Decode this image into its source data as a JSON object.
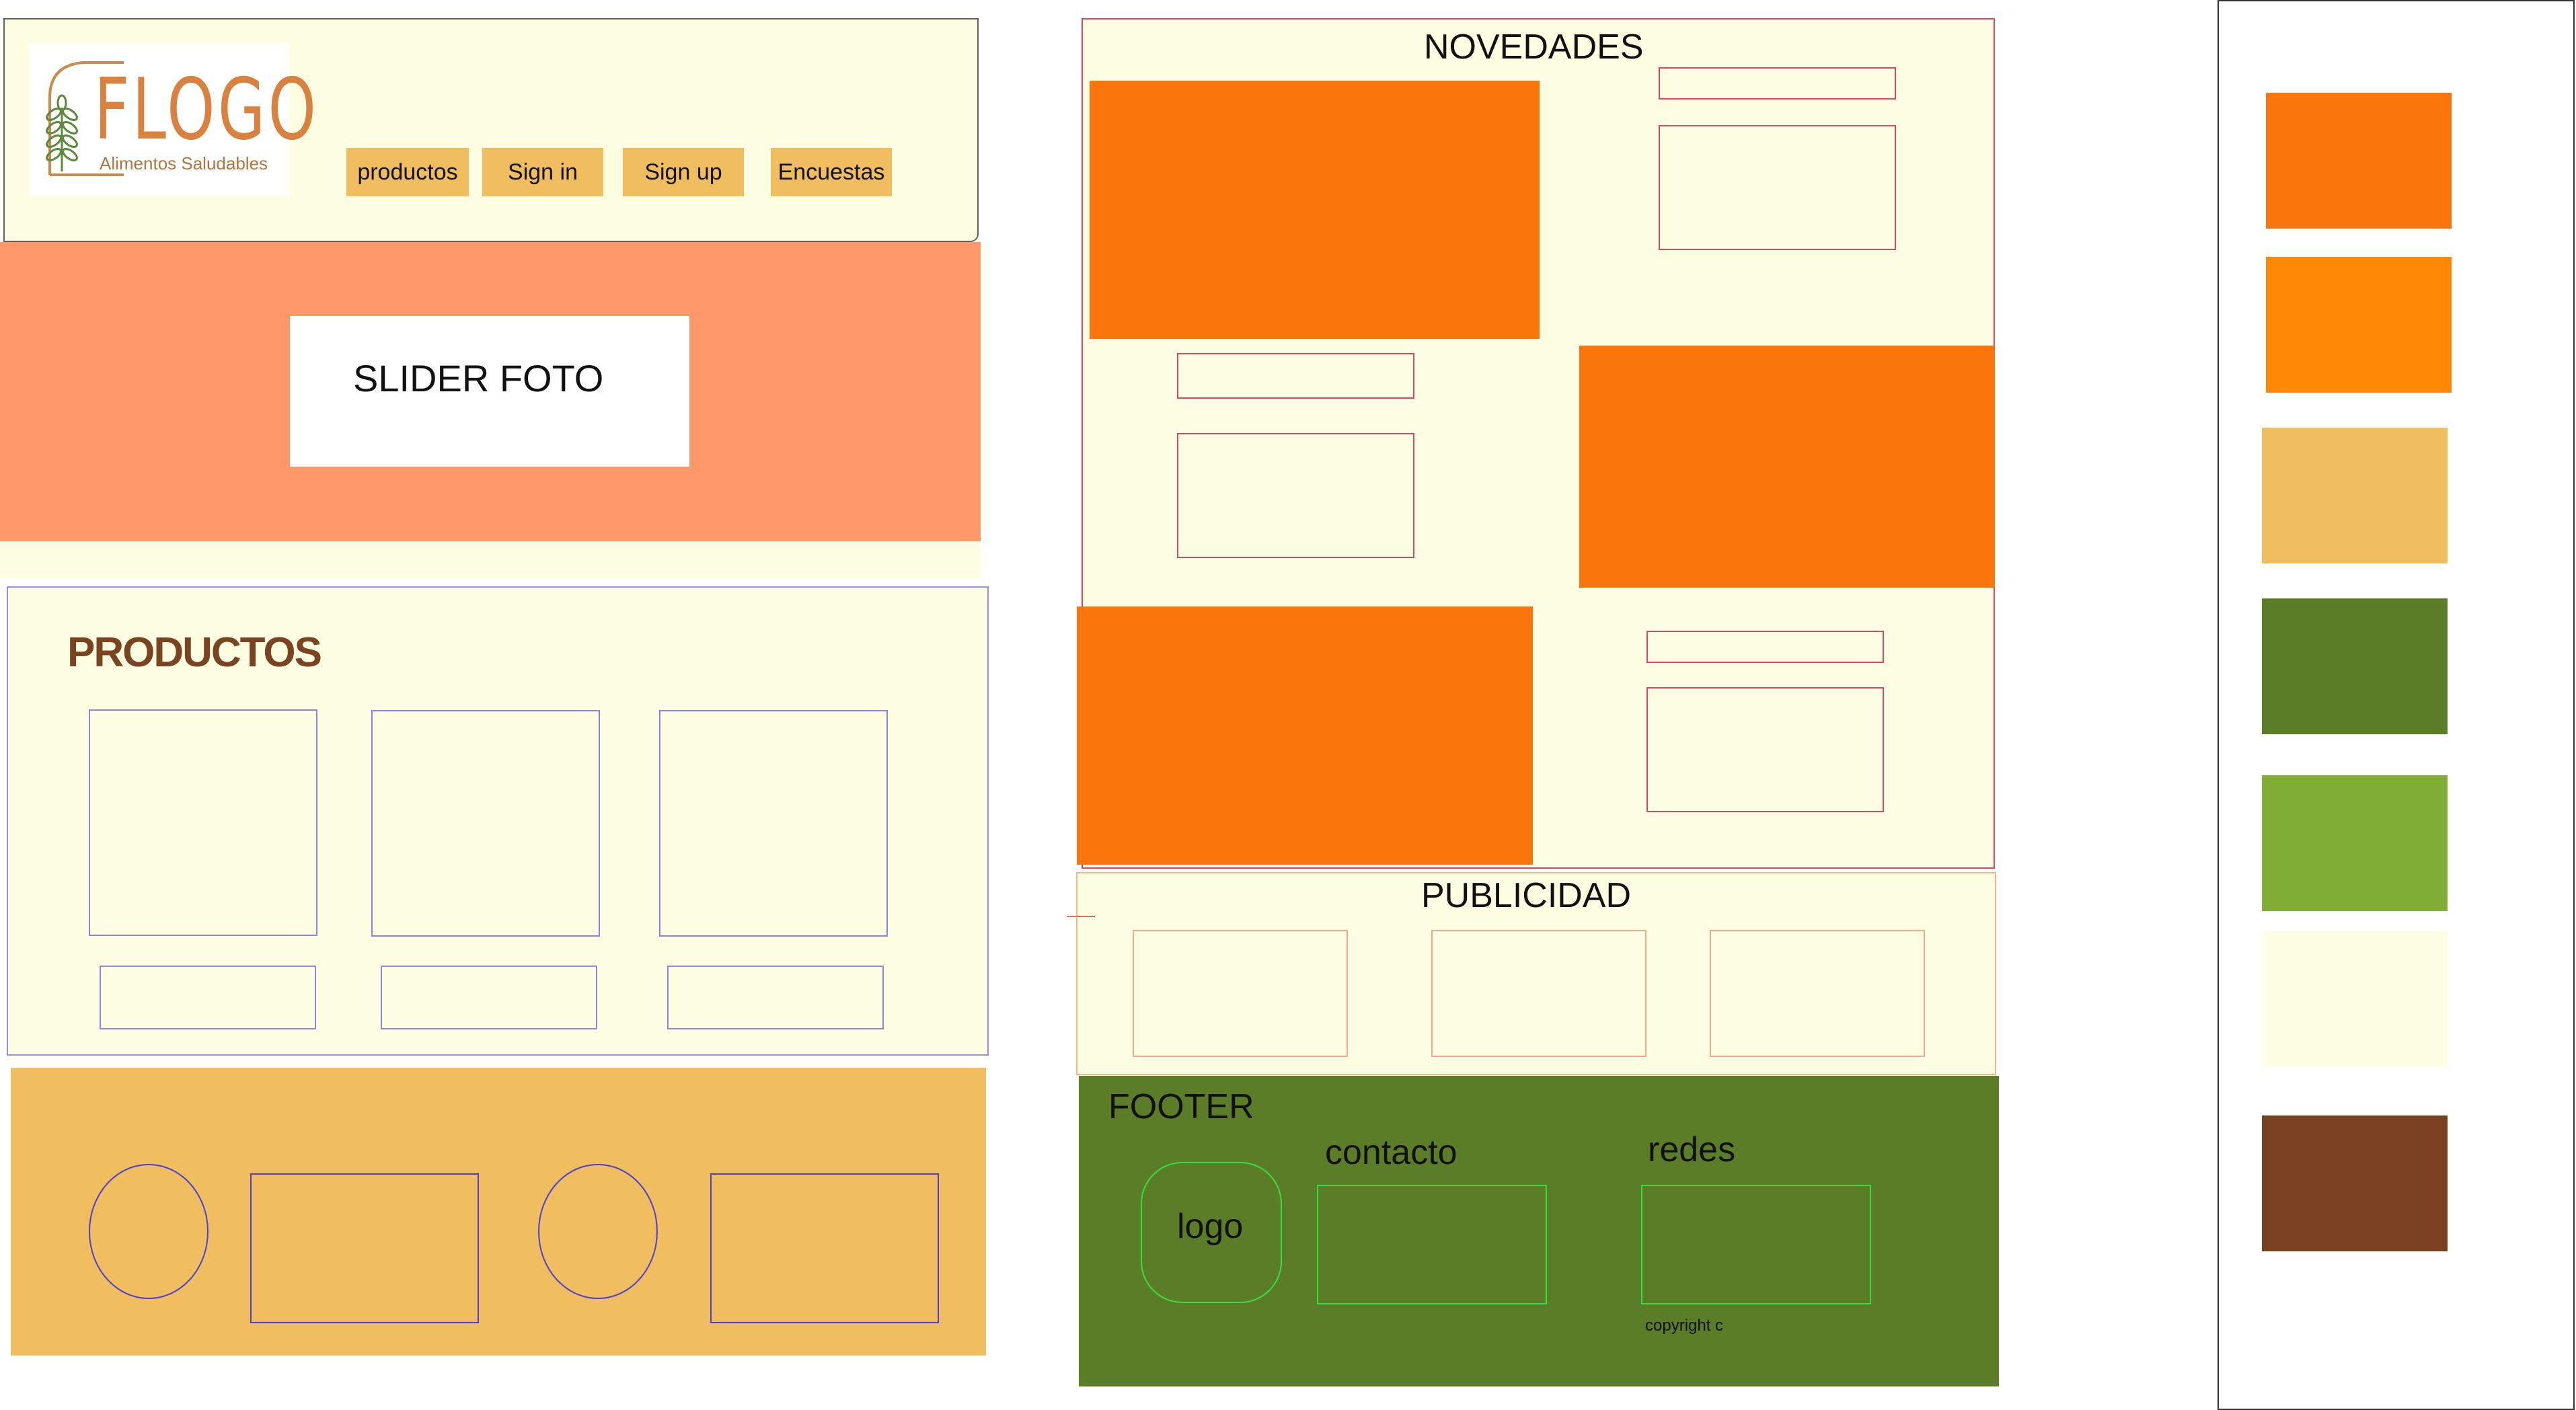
{
  "header": {
    "logo_text": "FLOGO",
    "logo_subtitle": "Alimentos Saludables",
    "nav": {
      "productos": "productos",
      "sign_in": "Sign in",
      "sign_up": "Sign up",
      "encuestas": "Encuestas"
    }
  },
  "slider": {
    "label": "SLIDER FOTO"
  },
  "productos": {
    "title": "PRODUCTOS"
  },
  "novedades": {
    "title": "NOVEDADES"
  },
  "publicidad": {
    "title": "PUBLICIDAD"
  },
  "footer": {
    "title": "FOOTER",
    "logo": "logo",
    "contacto": "contacto",
    "redes": "redes",
    "copyright": "copyright c"
  },
  "palette": [
    "#fa760d",
    "#ff8807",
    "#f0be5e",
    "#5b7d28",
    "#80ae34",
    "#fefee3",
    "#7a4022"
  ],
  "colors": {
    "background": "#fefee3",
    "slider": "#ff9868",
    "nav_button": "#f0be5e",
    "orange": "#fa760d",
    "footer_green": "#5b7d28",
    "brand_brown": "#7a4422"
  }
}
